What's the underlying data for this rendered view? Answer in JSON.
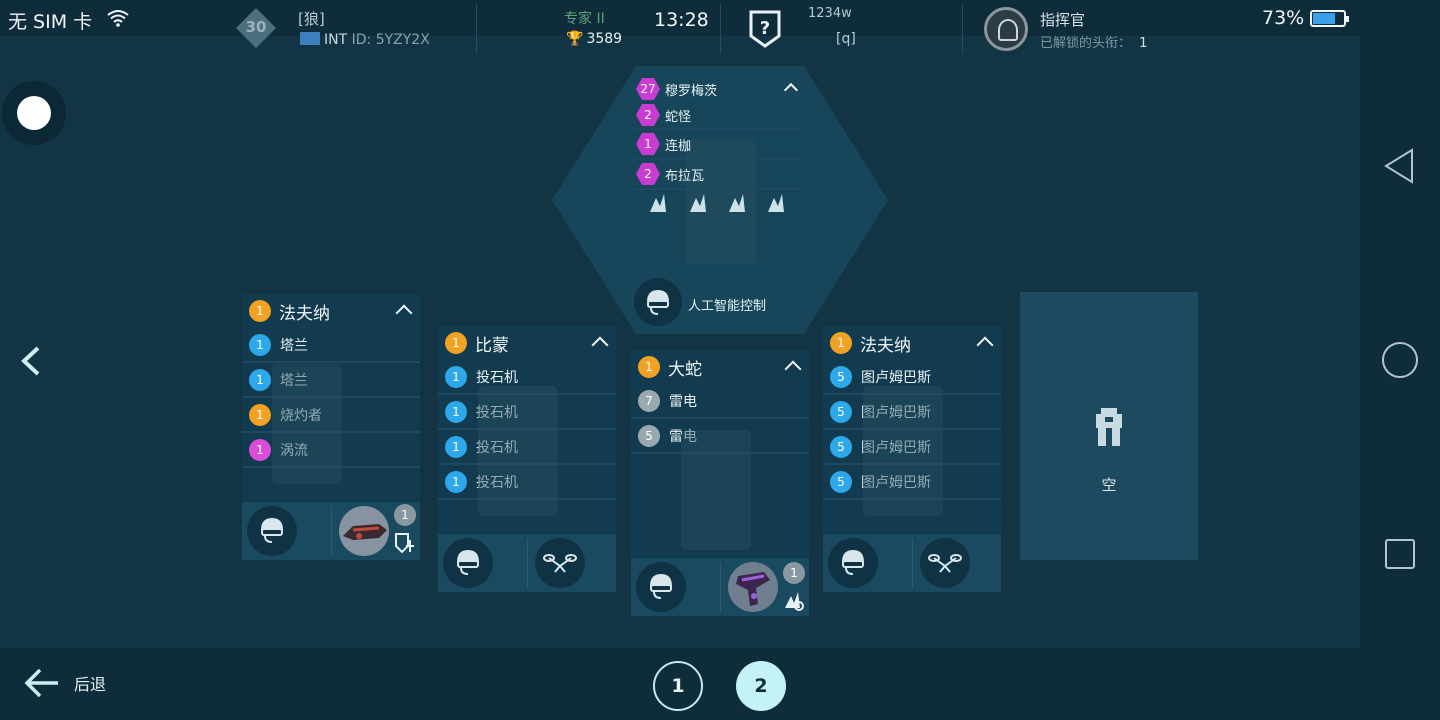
{
  "status_bar": {
    "carrier": "无 SIM 卡",
    "time": "13:28",
    "battery_percent": "73%",
    "battery_level": 0.73
  },
  "player": {
    "level": "30",
    "clan_tag": "[狼]",
    "region": "INT",
    "id_label": "ID:",
    "id_value": "5YZY2X",
    "league": "专家 II",
    "trophies": "3589"
  },
  "clan": {
    "power": "1234w",
    "tag": "[q]"
  },
  "commander": {
    "title": "指挥官",
    "unlocked_label": "已解锁的头衔：",
    "unlocked_count": "1"
  },
  "hex_card": {
    "items": [
      {
        "level": "27",
        "name": "穆罗梅茨"
      },
      {
        "level": "2",
        "name": "蛇怪"
      },
      {
        "level": "1",
        "name": "连枷"
      },
      {
        "level": "2",
        "name": "布拉瓦"
      }
    ],
    "ai_label": "人工智能控制"
  },
  "cards": [
    {
      "level": "1",
      "title": "法夫纳",
      "weapons": [
        {
          "level": "1",
          "name": "塔兰",
          "color": "#2da8ea"
        },
        {
          "level": "1",
          "name": "塔兰",
          "color": "#2da8ea"
        },
        {
          "level": "1",
          "name": "烧灼者",
          "color": "#f1a223"
        },
        {
          "level": "1",
          "name": "涡流",
          "color": "#d94bd8"
        }
      ],
      "module_level": "1"
    },
    {
      "level": "1",
      "title": "比蒙",
      "weapons": [
        {
          "level": "1",
          "name": "投石机",
          "color": "#2da8ea"
        },
        {
          "level": "1",
          "name": "投石机",
          "color": "#2da8ea"
        },
        {
          "level": "1",
          "name": "投石机",
          "color": "#2da8ea"
        },
        {
          "level": "1",
          "name": "投石机",
          "color": "#2da8ea"
        }
      ]
    },
    {
      "level": "1",
      "title": "大蛇",
      "weapons": [
        {
          "level": "7",
          "name": "雷电",
          "color": "#9aa9b0"
        },
        {
          "level": "5",
          "name": "雷电",
          "color": "#9aa9b0"
        }
      ],
      "module_level": "1"
    },
    {
      "level": "1",
      "title": "法夫纳",
      "weapons": [
        {
          "level": "5",
          "name": "图卢姆巴斯",
          "color": "#2da8ea"
        },
        {
          "level": "5",
          "name": "图卢姆巴斯",
          "color": "#2da8ea"
        },
        {
          "level": "5",
          "name": "图卢姆巴斯",
          "color": "#2da8ea"
        },
        {
          "level": "5",
          "name": "图卢姆巴斯",
          "color": "#2da8ea"
        }
      ]
    }
  ],
  "empty_slot_label": "空",
  "bottom": {
    "back_label": "后退",
    "pages": [
      "1",
      "2"
    ],
    "active_page": "2"
  },
  "colors": {
    "background": "#123445",
    "card": "#123b4f",
    "accent_orange": "#f1a223",
    "accent_blue": "#2da8ea",
    "accent_magenta": "#d94bd8"
  }
}
